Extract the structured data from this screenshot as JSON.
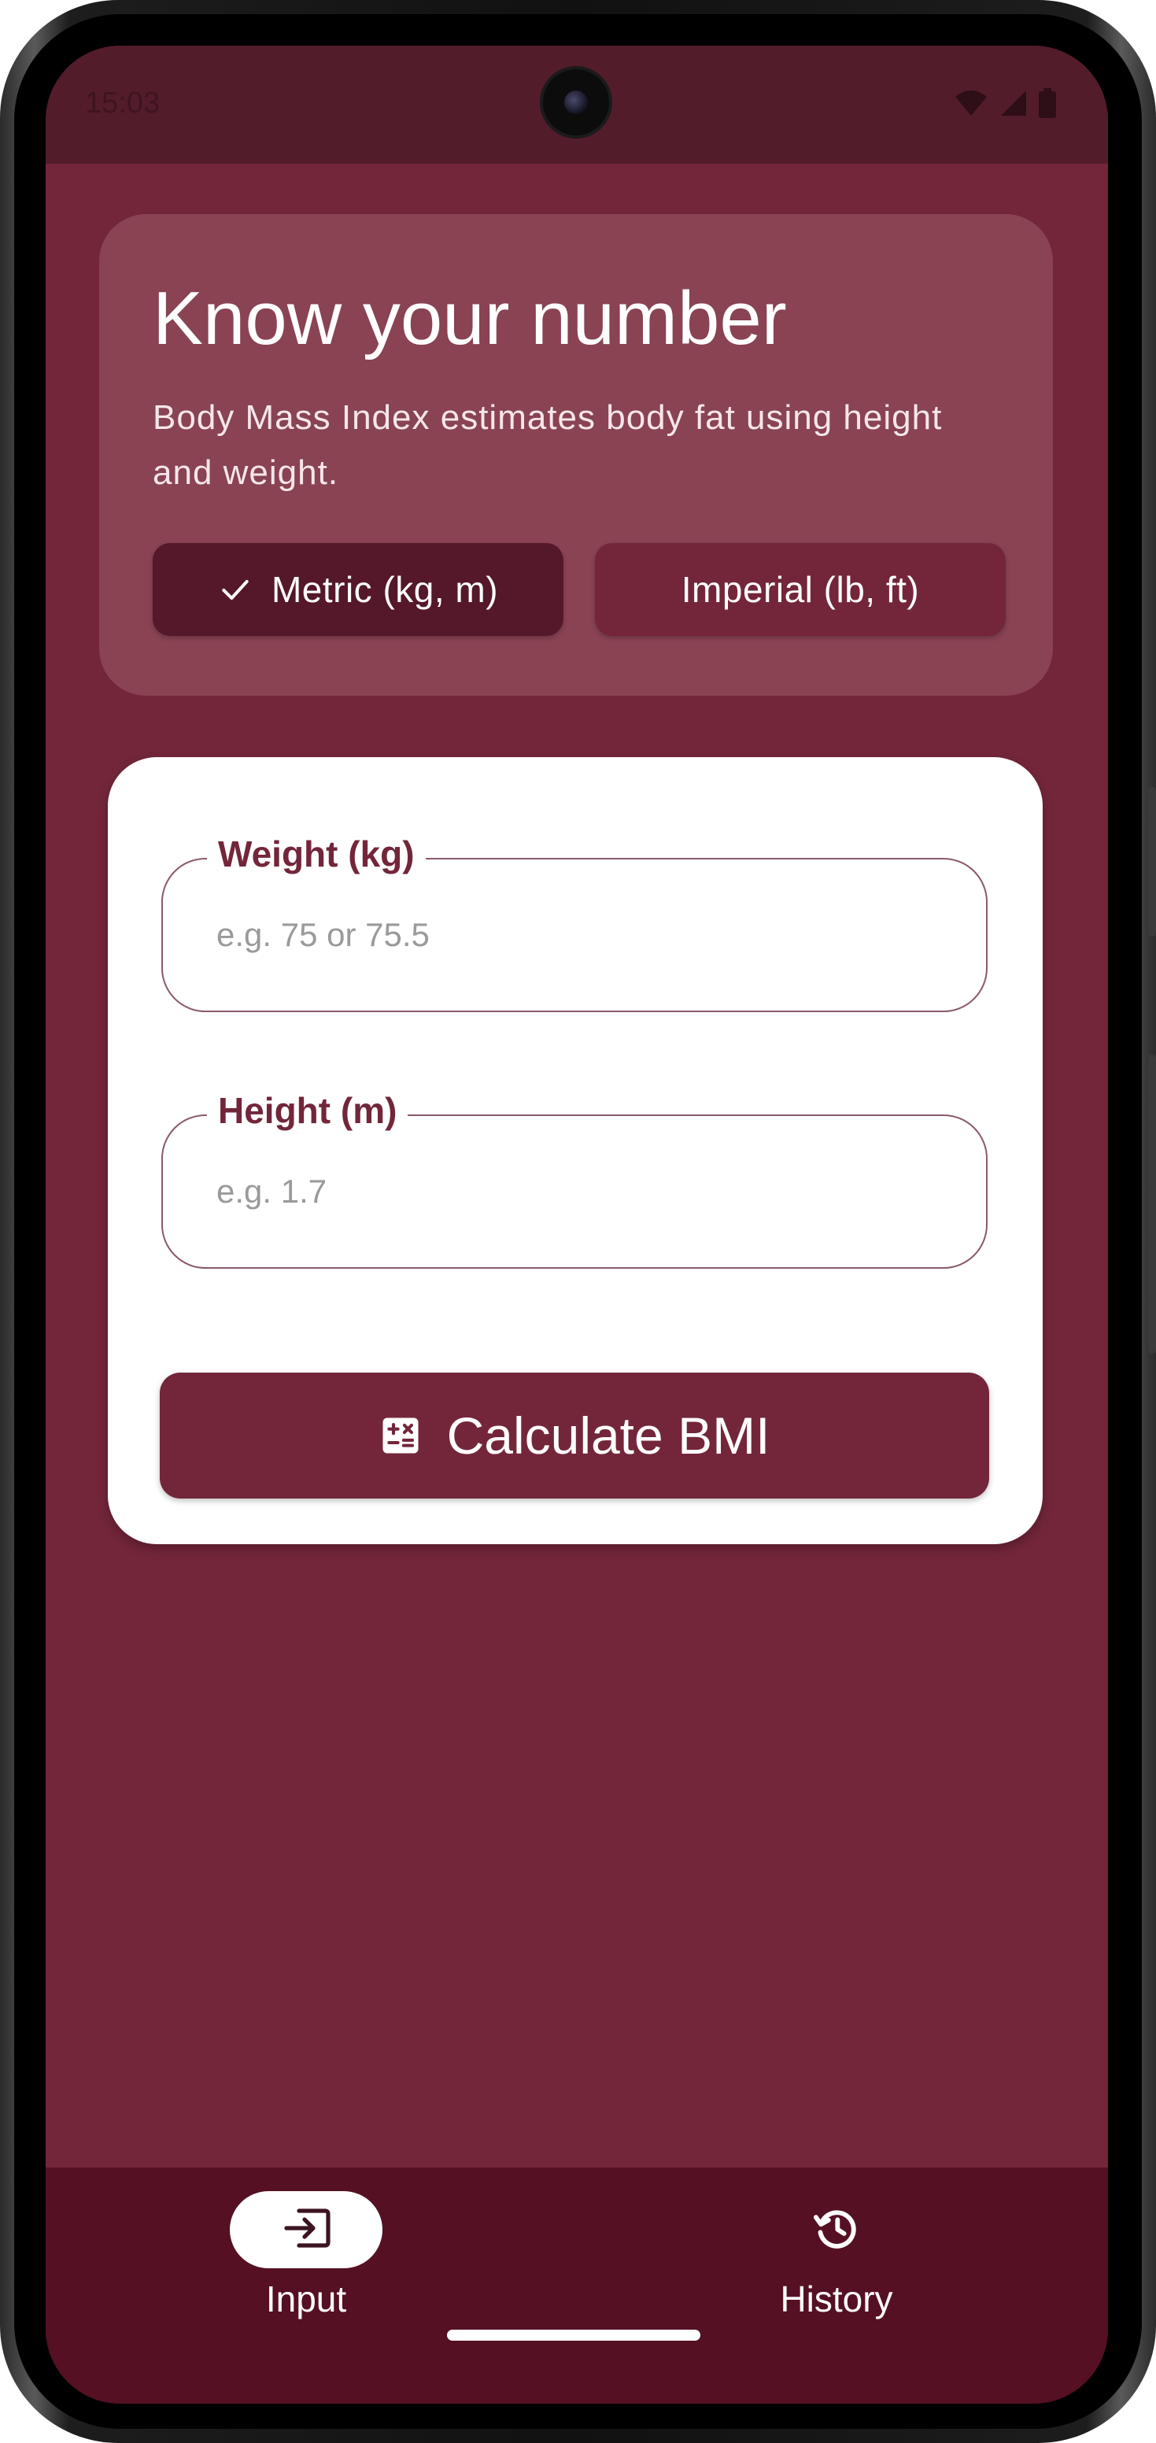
{
  "status_bar": {
    "time": "15:03",
    "icons": [
      "wifi-icon",
      "signal-icon",
      "battery-icon"
    ]
  },
  "hero": {
    "title": "Know your number",
    "description": "Body Mass Index estimates body fat using height and weight.",
    "units": {
      "selected": "metric",
      "metric_label": "Metric (kg, m)",
      "imperial_label": "Imperial (lb, ft)"
    }
  },
  "form": {
    "weight": {
      "label": "Weight (kg)",
      "value": "",
      "placeholder": "e.g. 75 or 75.5"
    },
    "height": {
      "label": "Height (m)",
      "value": "",
      "placeholder": "e.g. 1.7"
    },
    "submit_label": "Calculate BMI"
  },
  "nav": {
    "items": [
      {
        "label": "Input",
        "icon": "input-icon",
        "selected": true
      },
      {
        "label": "History",
        "icon": "history-icon",
        "selected": false
      }
    ]
  },
  "colors": {
    "background": "#73263a",
    "status_bar": "#521c2b",
    "hero_card": "#894353",
    "selected_segment": "#55172a",
    "nav_bar": "#551023",
    "accent": "#73263a"
  }
}
